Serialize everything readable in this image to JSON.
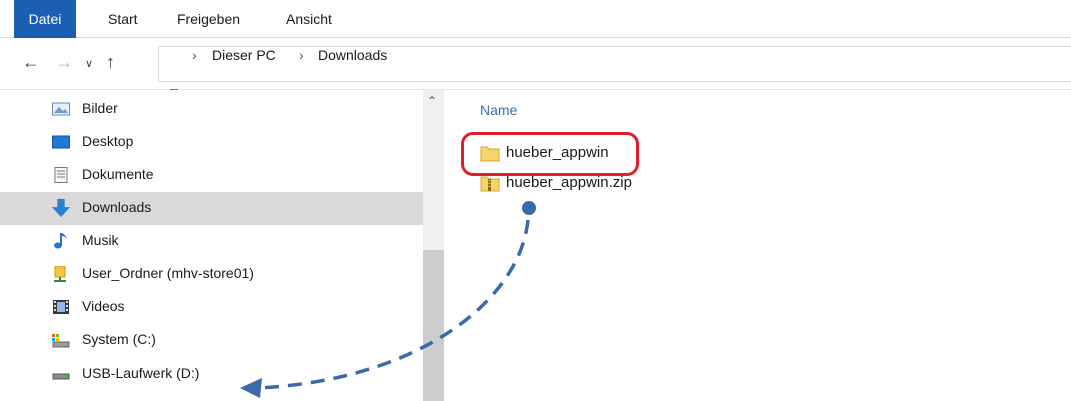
{
  "ribbon": {
    "tabs": [
      {
        "label": "Datei"
      },
      {
        "label": "Start"
      },
      {
        "label": "Freigeben"
      },
      {
        "label": "Ansicht"
      }
    ]
  },
  "address": {
    "crumbs": [
      {
        "label": "Dieser PC"
      },
      {
        "label": "Downloads"
      }
    ]
  },
  "nav": {
    "items": [
      {
        "label": "Bilder",
        "icon": "pictures-icon"
      },
      {
        "label": "Desktop",
        "icon": "desktop-icon"
      },
      {
        "label": "Dokumente",
        "icon": "documents-icon"
      },
      {
        "label": "Downloads",
        "icon": "downloads-icon",
        "selected": true
      },
      {
        "label": "Musik",
        "icon": "music-icon"
      },
      {
        "label": "User_Ordner (mhv-store01)",
        "icon": "network-folder-icon"
      },
      {
        "label": "Videos",
        "icon": "videos-icon"
      },
      {
        "label": "System (C:)",
        "icon": "system-drive-icon"
      },
      {
        "label": "USB-Laufwerk (D:)",
        "icon": "usb-drive-icon"
      }
    ]
  },
  "content": {
    "column_header": "Name",
    "files": [
      {
        "label": "hueber_appwin",
        "icon": "folder-icon"
      },
      {
        "label": "hueber_appwin.zip",
        "icon": "zip-folder-icon"
      }
    ]
  },
  "colors": {
    "accent": "#1a5fb4",
    "selection": "#d9d9d9",
    "highlight": "#e01e2b",
    "arrow": "#3a6aa8"
  }
}
